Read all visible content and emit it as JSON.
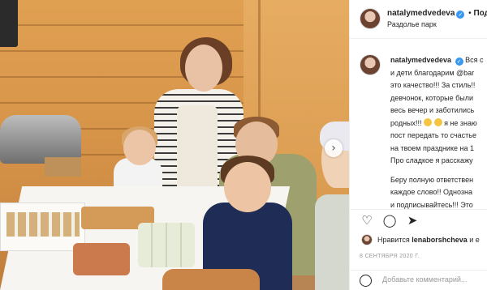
{
  "post": {
    "username": "natalymedvedeva",
    "separator": "•",
    "follow_label": "Под",
    "location": "Раздолье парк"
  },
  "caption": {
    "author": "natalymedvedeva",
    "lines": [
      "Вся с",
      "и дети благодарим @bar",
      "это качество!!! За стиль!!",
      "девчонок, которые были",
      "весь вечер и заботились",
      "родных!!!",
      "я не знаю",
      "пост передать то счастье",
      "на твоем празднике на 1",
      "Про сладкое я расскажу",
      "Беру полную ответствен",
      "каждое слово!! Однозна",
      "и подписывайтесь!!! Это"
    ],
    "mention": "@bar"
  },
  "actions": {
    "like_icon": "heart-icon",
    "comment_icon": "comment-icon",
    "share_icon": "share-icon"
  },
  "likes": {
    "prefix": "Нравится",
    "user": "lenaborshcheva",
    "suffix": "и е"
  },
  "date": "8 СЕНТЯБРЯ 2020 Г.",
  "comment": {
    "placeholder": "Добавьте комментарий..."
  },
  "carousel": {
    "next_icon": "chevron-right-icon",
    "next_glyph": "›"
  },
  "colors": {
    "link": "#003569",
    "verified": "#3897f0",
    "muted": "#999999"
  }
}
